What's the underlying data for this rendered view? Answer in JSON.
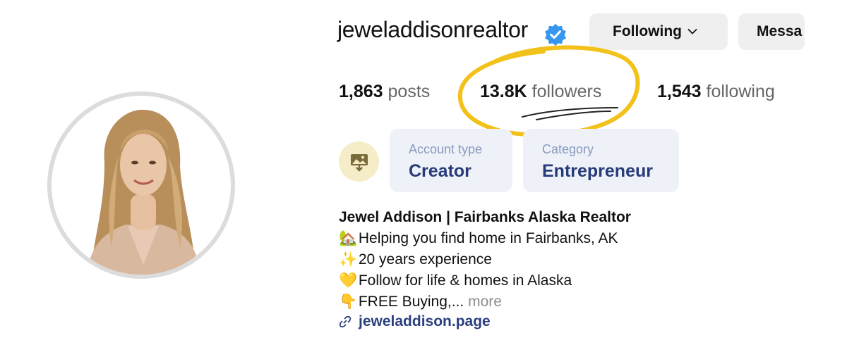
{
  "profile": {
    "username": "jeweladdisonrealtor",
    "verified": true,
    "verified_icon": "verified-badge-icon",
    "avatar_icon": "profile-photo-avatar"
  },
  "actions": {
    "following_label": "Following",
    "message_label": "Messa"
  },
  "stats": {
    "posts_count": "1,863",
    "posts_label": "posts",
    "followers_count": "13.8K",
    "followers_label": "followers",
    "following_count": "1,543",
    "following_label": "following"
  },
  "professional": {
    "icon": "professional-dashboard-icon",
    "cards": [
      {
        "title": "Account type",
        "value": "Creator"
      },
      {
        "title": "Category",
        "value": "Entrepreneur"
      }
    ]
  },
  "bio": {
    "name": "Jewel Addison | Fairbanks Alaska Realtor",
    "lines": [
      {
        "emoji": "🏡",
        "text": "Helping you find home in Fairbanks, AK"
      },
      {
        "emoji": "✨",
        "text": "20 years experience"
      },
      {
        "emoji": "💛",
        "text": "Follow for life & homes in Alaska"
      },
      {
        "emoji": "👇",
        "text": "FREE Buying,...",
        "more": "more"
      }
    ],
    "link": "jeweladdison.page",
    "link_icon": "link-icon"
  },
  "colors": {
    "highlight": "#f2c21b",
    "verified": "#3797f0",
    "link": "#2b3f7e",
    "card_bg": "#eef1f7",
    "card_value": "#273b7a"
  }
}
